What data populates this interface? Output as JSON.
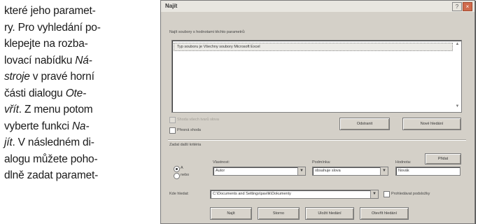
{
  "article": {
    "lines": [
      [
        "které jeho paramet-"
      ],
      [
        "ry. Pro vyhledání po-"
      ],
      [
        "klepejte na rozba-"
      ],
      [
        "lovací nabídku ",
        {
          "em": "Ná-"
        }
      ],
      [
        {
          "em": "stroje"
        },
        " v pravé horní"
      ],
      [
        "části dialogu ",
        {
          "em": "Ote-"
        }
      ],
      [
        {
          "em": "vřít"
        },
        ". Z menu potom"
      ],
      [
        "vyberte funkci ",
        {
          "em": "Na-"
        }
      ],
      [
        {
          "em": "jít"
        },
        ". V následném di-"
      ],
      [
        "alogu můžete poho-"
      ],
      [
        "dlně zadat paramet-"
      ]
    ]
  },
  "dialog": {
    "title": "Najít",
    "help_button": "?",
    "close_button": "×",
    "results_label": "Najít soubory s hodnotami těchto parametrů:",
    "results_row": "Typ souboru je Všechny soubory Microsoft Excel",
    "match_all_forms": "Shoda všech tvarů slova",
    "exact_match": "Přesná shoda",
    "delete_button": "Odstranit",
    "new_search_button": "Nové hledání",
    "define_more_label": "Zadat další kritéria",
    "add_to_list_button": "Přidat",
    "and_label": "A",
    "or_label": "nebo",
    "property_label": "Vlastnost:",
    "property_value": "Autor",
    "condition_label": "Podmínka:",
    "condition_value": "obsahuje slova",
    "value_label": "Hodnota:",
    "value_value": "Novák",
    "look_in_label": "Kde hledat:",
    "look_in_value": "C:\\Documents and Settings\\pavlik\\Dokumenty",
    "search_subfolders": "Prohledávat podsložky",
    "find_now_button": "Najít",
    "cancel_button": "Storno",
    "save_search_button": "Uložit hledání",
    "open_search_button": "Otevřít hledání"
  }
}
